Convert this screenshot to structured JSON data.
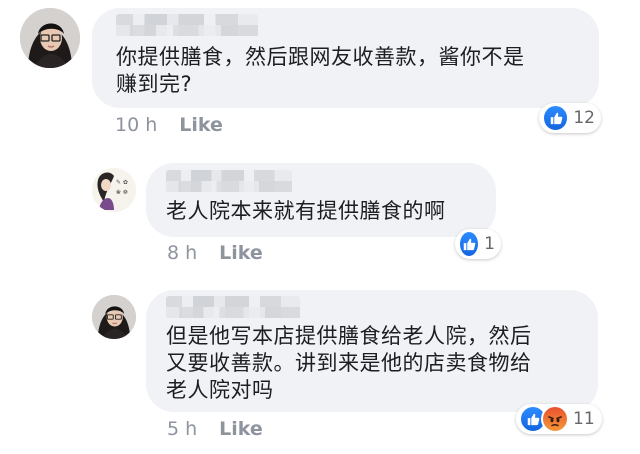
{
  "comments": [
    {
      "text": "你提供膳食，然后跟网友收善款，酱你不是\n赚到完?",
      "time": "10 h",
      "like_label": "Like",
      "reaction_count": "12"
    },
    {
      "text": "老人院本来就有提供膳食的啊",
      "time": "8 h",
      "like_label": "Like",
      "reaction_count": "1"
    },
    {
      "text": "但是他写本店提供膳食给老人院，然后\n又要收善款。讲到来是他的店卖食物给\n老人院对吗",
      "time": "5 h",
      "like_label": "Like",
      "reaction_count": "11"
    }
  ],
  "icons": {
    "like": "thumbs-up-icon",
    "angry": "angry-face-icon"
  },
  "colors": {
    "bubble": "#f0f2f5",
    "meta_text": "#8d949e",
    "like_reaction": "#1877f2",
    "angry_reaction": "#f0663a"
  }
}
